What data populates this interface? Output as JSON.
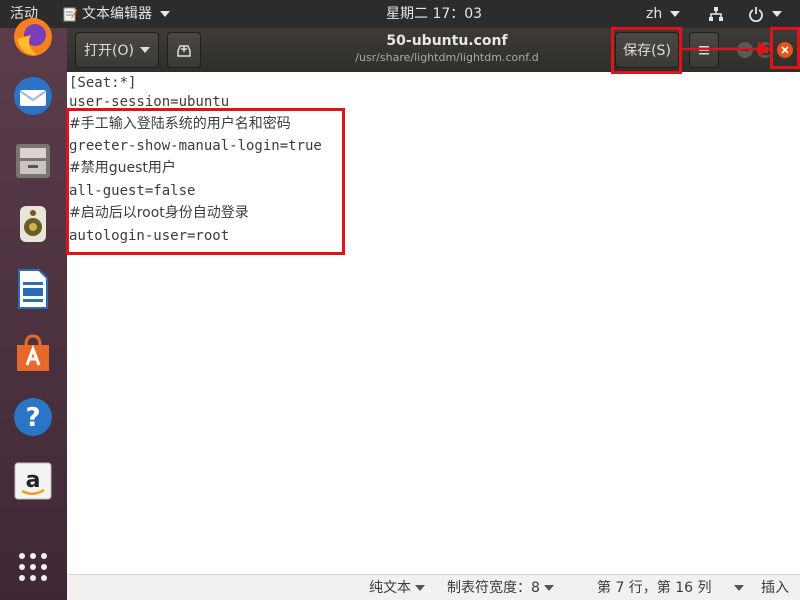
{
  "topbar": {
    "activities": "活动",
    "app_menu": "文本编辑器",
    "clock": "星期二 17：03",
    "input_method": "zh"
  },
  "dock": {
    "icons": [
      "firefox-icon",
      "thunderbird-icon",
      "files-icon",
      "rhythmbox-icon",
      "libreoffice-writer-icon",
      "software-center-icon",
      "help-icon",
      "amazon-icon",
      "show-apps-icon"
    ]
  },
  "header": {
    "open_label": "打开(O)",
    "title": "50-ubuntu.conf",
    "subtitle": "/usr/share/lightdm/lightdm.conf.d",
    "save_label": "保存(S)"
  },
  "editor": {
    "lines": [
      "[Seat:*]",
      "user-session=ubuntu",
      "#手工输入登陆系统的用户名和密码",
      "greeter-show-manual-login=true",
      "#禁用guest用户",
      "all-guest=false",
      "#启动后以root身份自动登录",
      "autologin-user=root"
    ]
  },
  "statusbar": {
    "syntax": "纯文本",
    "tab_width": "制表符宽度：8",
    "position": "第 7 行，第 16 列",
    "mode": "插入"
  },
  "colors": {
    "highlight": "#e0121b",
    "close_button": "#e5531a",
    "dock_bg": "#5b3d4a"
  }
}
